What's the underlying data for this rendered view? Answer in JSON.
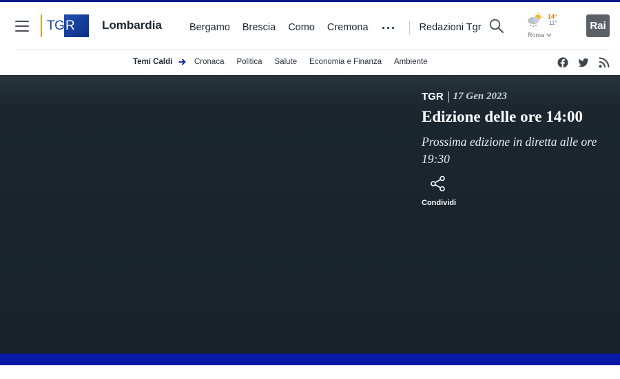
{
  "header": {
    "logo_tg": "TG",
    "logo_r": "R",
    "region": "Lombardia",
    "nav_items": [
      "Bergamo",
      "Brescia",
      "Como",
      "Cremona"
    ],
    "redazioni": "Redazioni Tgr",
    "weather": {
      "max": "14°",
      "min": "11°",
      "city": "Roma",
      "icon": "cloud-sun-rain-icon"
    },
    "rai_logo": "Rai"
  },
  "subnav": {
    "hot_topics": "Temi Caldi",
    "links": [
      "Cronaca",
      "Politica",
      "Salute",
      "Economia e Finanza",
      "Ambiente"
    ],
    "social": [
      "facebook-icon",
      "twitter-icon",
      "rss-icon"
    ]
  },
  "hero": {
    "brand": "TGR",
    "date": "17 Gen 2023",
    "title": "Edizione delle ore 14:00",
    "subtitle": "Prossima edizione in diretta alle ore 19:30",
    "share_label": "Condividi"
  },
  "colors": {
    "accent_blue": "#0a18a8",
    "hero_bg": "#17222a",
    "logo_orange": "#f39a1c"
  }
}
